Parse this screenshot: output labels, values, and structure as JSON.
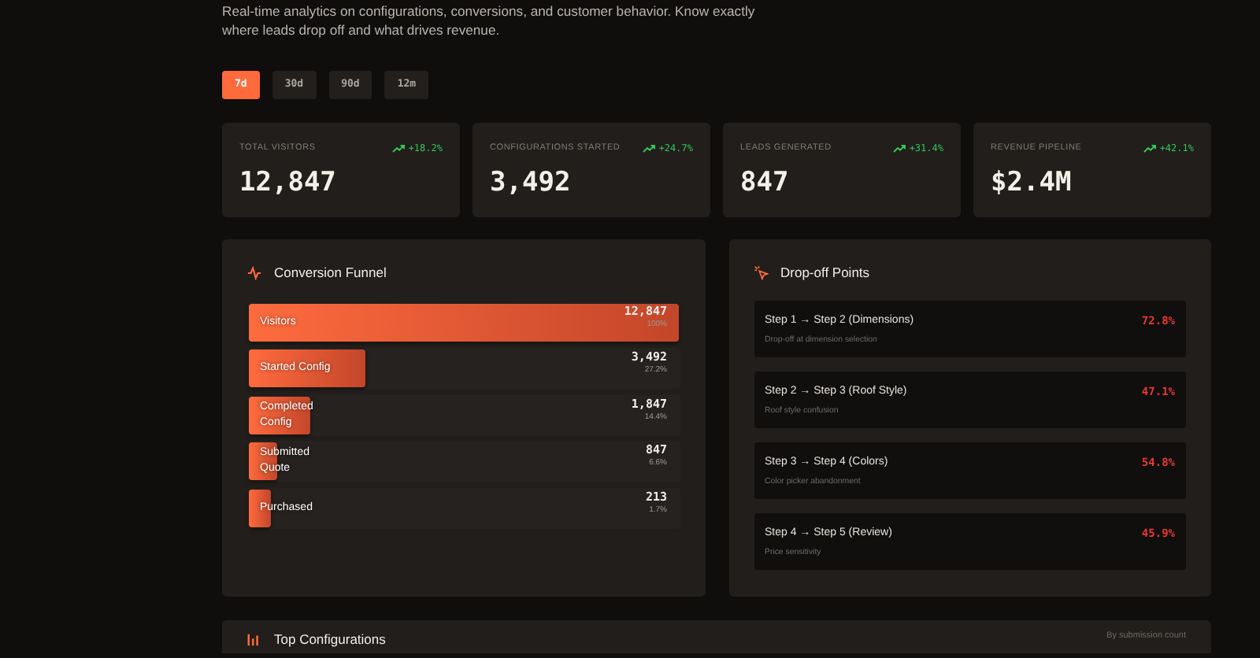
{
  "intro": {
    "text": "Real-time analytics on configurations, conversions, and customer behavior. Know exactly where leads drop off and what drives revenue."
  },
  "ranges": [
    {
      "label": "7d",
      "selected": true
    },
    {
      "label": "30d",
      "selected": false
    },
    {
      "label": "90d",
      "selected": false
    },
    {
      "label": "12m",
      "selected": false
    }
  ],
  "stats": [
    {
      "label": "TOTAL VISITORS",
      "change": "+18.2%",
      "value": "12,847"
    },
    {
      "label": "CONFIGURATIONS STARTED",
      "change": "+24.7%",
      "value": "3,492"
    },
    {
      "label": "LEADS GENERATED",
      "change": "+31.4%",
      "value": "847"
    },
    {
      "label": "REVENUE PIPELINE",
      "change": "+42.1%",
      "value": "$2.4M"
    }
  ],
  "funnel": {
    "title": "Conversion Funnel",
    "stages": [
      {
        "label": "Visitors",
        "count": "12,847",
        "share": "100%",
        "level": 1.0
      },
      {
        "label": "Started Config",
        "count": "3,492",
        "share": "27.2%",
        "level": 0.272
      },
      {
        "label": "Completed Config",
        "count": "1,847",
        "share": "14.4%",
        "level": 0.144
      },
      {
        "label": "Submitted Quote",
        "count": "847",
        "share": "6.6%",
        "level": 0.066
      },
      {
        "label": "Purchased",
        "count": "213",
        "share": "1.7%",
        "level": 0.017
      }
    ]
  },
  "dropoffs": {
    "title": "Drop-off Points",
    "items": [
      {
        "title": "Step 1 → Step 2 (Dimensions)",
        "detail": "Drop-off at dimension selection",
        "rate": "72.8%"
      },
      {
        "title": "Step 2 → Step 3 (Roof Style)",
        "detail": "Roof style confusion",
        "rate": "47.1%"
      },
      {
        "title": "Step 3 → Step 4 (Colors)",
        "detail": "Color picker abandonment",
        "rate": "54.8%"
      },
      {
        "title": "Step 4 → Step 5 (Review)",
        "detail": "Price sensitivity",
        "rate": "45.9%"
      }
    ]
  },
  "top_configurations": {
    "title": "Top Configurations",
    "note": "By submission count"
  }
}
